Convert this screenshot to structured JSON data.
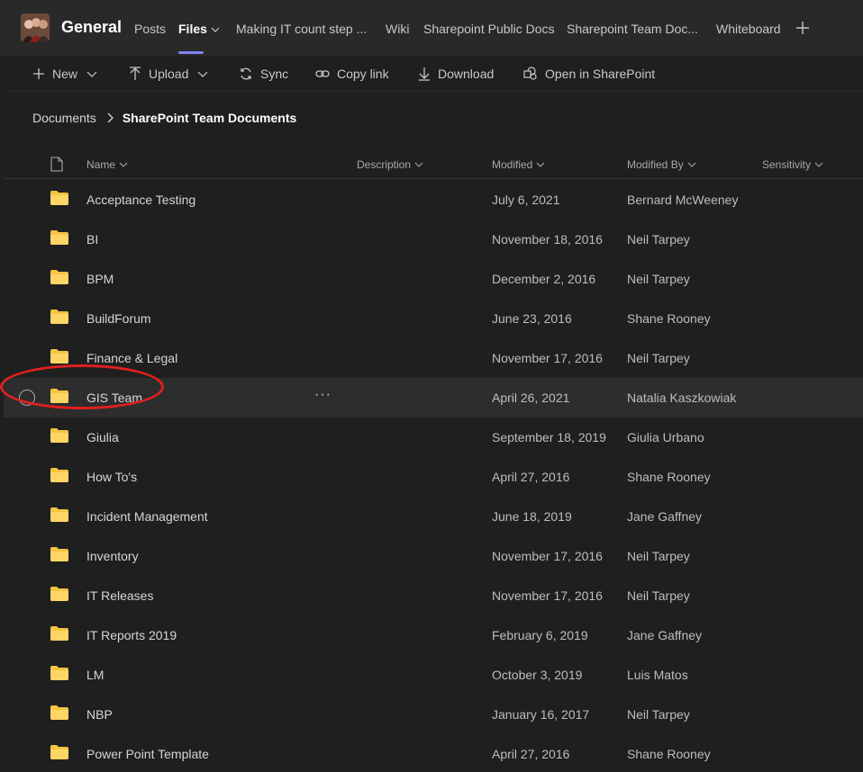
{
  "header": {
    "team_name": "General",
    "tabs": [
      {
        "label": "Posts"
      },
      {
        "label": "Files"
      },
      {
        "label": "Making IT count step ..."
      },
      {
        "label": "Wiki"
      },
      {
        "label": "Sharepoint Public Docs"
      },
      {
        "label": "Sharepoint Team Doc..."
      },
      {
        "label": "Whiteboard"
      }
    ]
  },
  "toolbar": {
    "new_label": "New",
    "upload_label": "Upload",
    "sync_label": "Sync",
    "copy_link_label": "Copy link",
    "download_label": "Download",
    "open_sharepoint_label": "Open in SharePoint"
  },
  "breadcrumb": {
    "root": "Documents",
    "current": "SharePoint Team Documents"
  },
  "columns": {
    "name": "Name",
    "description": "Description",
    "modified": "Modified",
    "modified_by": "Modified By",
    "sensitivity": "Sensitivity"
  },
  "rows": [
    {
      "name": "Acceptance Testing",
      "modified": "July 6, 2021",
      "modified_by": "Bernard McWeeney"
    },
    {
      "name": "BI",
      "modified": "November 18, 2016",
      "modified_by": "Neil Tarpey"
    },
    {
      "name": "BPM",
      "modified": "December 2, 2016",
      "modified_by": "Neil Tarpey"
    },
    {
      "name": "BuildForum",
      "modified": "June 23, 2016",
      "modified_by": "Shane Rooney"
    },
    {
      "name": "Finance & Legal",
      "modified": "November 17, 2016",
      "modified_by": "Neil Tarpey"
    },
    {
      "name": "GIS Team",
      "modified": "April 26, 2021",
      "modified_by": "Natalia Kaszkowiak"
    },
    {
      "name": "Giulia",
      "modified": "September 18, 2019",
      "modified_by": "Giulia Urbano"
    },
    {
      "name": "How To's",
      "modified": "April 27, 2016",
      "modified_by": "Shane Rooney"
    },
    {
      "name": "Incident Management",
      "modified": "June 18, 2019",
      "modified_by": "Jane Gaffney"
    },
    {
      "name": "Inventory",
      "modified": "November 17, 2016",
      "modified_by": "Neil Tarpey"
    },
    {
      "name": "IT Releases",
      "modified": "November 17, 2016",
      "modified_by": "Neil Tarpey"
    },
    {
      "name": "IT Reports 2019",
      "modified": "February 6, 2019",
      "modified_by": "Jane Gaffney"
    },
    {
      "name": "LM",
      "modified": "October 3, 2019",
      "modified_by": "Luis Matos"
    },
    {
      "name": "NBP",
      "modified": "January 16, 2017",
      "modified_by": "Neil Tarpey"
    },
    {
      "name": "Power Point Template",
      "modified": "April 27, 2016",
      "modified_by": "Shane Rooney"
    }
  ],
  "more_glyph": "···",
  "colors": {
    "accent": "#7f85f5",
    "folder": "#f5c542",
    "highlight": "#e0201f",
    "background": "#1f1f1f"
  }
}
